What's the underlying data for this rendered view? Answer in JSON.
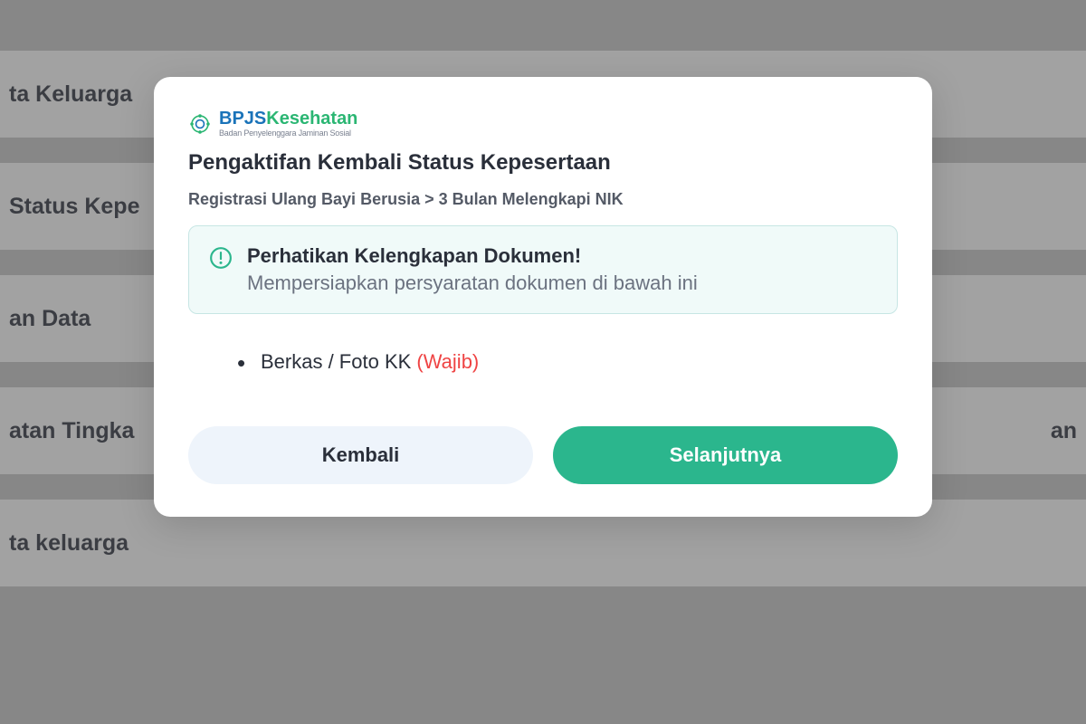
{
  "background": {
    "rows": [
      {
        "left": "ta Keluarga",
        "right": ""
      },
      {
        "left": " Status Kepe",
        "right": ""
      },
      {
        "left": "an Data",
        "right": ""
      },
      {
        "left": "atan Tingka",
        "right": "an"
      },
      {
        "left": "ta keluarga",
        "right": ""
      }
    ]
  },
  "logo": {
    "part1": "BPJS",
    "part2": "Kesehatan",
    "subtitle": "Badan Penyelenggara Jaminan Sosial"
  },
  "modal": {
    "title": "Pengaktifan Kembali Status Kepesertaan",
    "subtitle": "Registrasi Ulang Bayi Berusia > 3 Bulan Melengkapi NIK"
  },
  "alert": {
    "title": "Perhatikan Kelengkapan Dokumen!",
    "desc": "Mempersiapkan persyaratan dokumen di bawah ini"
  },
  "requirements": {
    "item1_label": "Berkas / Foto KK ",
    "item1_required": "(Wajib)"
  },
  "buttons": {
    "back": "Kembali",
    "next": "Selanjutnya"
  }
}
